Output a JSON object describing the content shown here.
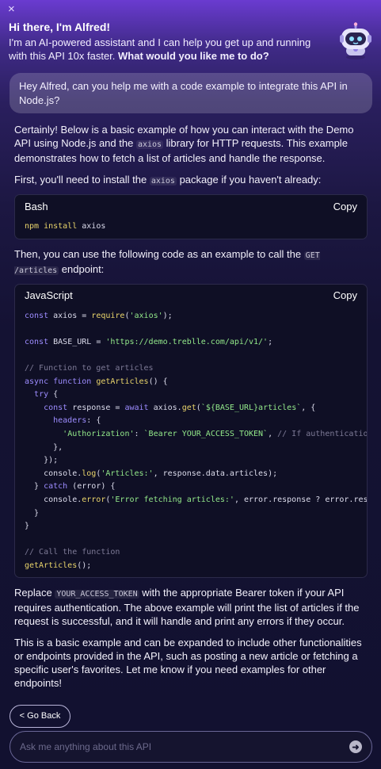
{
  "header": {
    "close_icon": "×",
    "greeting": "Hi there, I'm Alfred!",
    "intro_text": "I'm an AI-powered assistant and I can help you get up and running with this API 10x faster. ",
    "intro_bold": "What would you like me to do?"
  },
  "user_message": "Hey Alfred, can you help me with a code example to integrate this API in Node.js?",
  "response": {
    "p1_a": "Certainly! Below is a basic example of how you can interact with the Demo API using Node.js and the ",
    "p1_code": "axios",
    "p1_b": " library for HTTP requests. This example demonstrates how to fetch a list of articles and handle the response.",
    "p2_a": "First, you'll need to install the ",
    "p2_code": "axios",
    "p2_b": " package if you haven't already:",
    "bash_block": {
      "language": "Bash",
      "copy_label": "Copy",
      "code": "npm install axios"
    },
    "p3_a": "Then, you can use the following code as an example to call the ",
    "p3_code": "GET /articles",
    "p3_b": " endpoint:",
    "js_block": {
      "language": "JavaScript",
      "copy_label": "Copy"
    },
    "p4_a": "Replace ",
    "p4_code": "YOUR_ACCESS_TOKEN",
    "p4_b": " with the appropriate Bearer token if your API requires authentication. The above example will print the list of articles if the request is successful, and it will handle and print any errors if they occur.",
    "p5": "This is a basic example and can be expanded to include other functionalities or endpoints provided in the API, such as posting a new article or fetching a specific user's favorites. Let me know if you need examples for other endpoints!"
  },
  "footer": {
    "back_label": "< Go Back",
    "ask_placeholder": "Ask me anything about this API",
    "send_icon": "➜"
  }
}
